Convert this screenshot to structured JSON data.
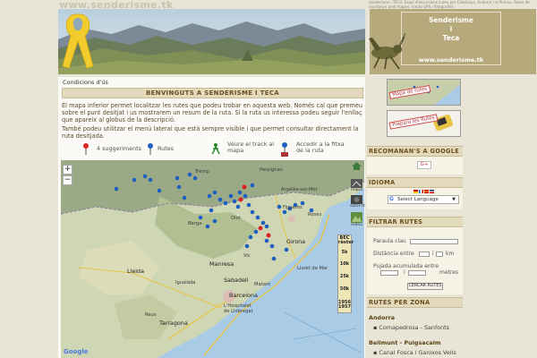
{
  "header": {
    "site_name": "www.senderisme.tk",
    "top_description": "senderisme i TECA. Espai d'excursions a peu per Catalunya, Andorra i el Pirineu. Rutes de muntanya amb mapes, tracks GPS i fotografies.",
    "brand_line1": "Senderisme",
    "brand_line2": "i",
    "brand_line3": "Teca",
    "brand_url": "www.senderisme.tk"
  },
  "main": {
    "conditions_link": "Condicions d'ús",
    "welcome_title": "BENVINGUTS A SENDERISME I TECA",
    "intro_paragraph": "El mapa inferior permet localitzar les rutes que podeu trobar en aquesta web. Només cal que premeu sobre el punt desitjat i us mostrarem un resum de la ruta. Si la ruta us interessa podeu seguir l'enllaç que apareix al globus de la descripció.",
    "menu_paragraph": "També podeu utilitzar el menú lateral que està sempre visible i que permet consultar directament la ruta desitjada.",
    "legend": {
      "suggestions": "4 suggeriments",
      "routes": "Rutes",
      "track_line1": "Veure el track al",
      "track_line2": "mapa",
      "sheet_line1": "Accedir a la fitxa",
      "sheet_line2": "de la ruta"
    }
  },
  "map": {
    "zoom_in": "+",
    "zoom_out": "−",
    "places": {
      "perpignan": "Perpignan",
      "figueres": "Figueres",
      "girona": "Girona",
      "vic": "Vic",
      "manresa": "Manresa",
      "sabadell": "Sabadell",
      "barcelona": "Barcelona",
      "hospitalet_1": "L'Hospitalet",
      "hospitalet_2": "de Llobregat",
      "lleida": "Lleida",
      "tarragona": "Tarragona",
      "argeles": "Argelès-sur-Mer",
      "roses": "Roses",
      "igualada": "Igualada",
      "mataro": "Mataró",
      "lloret": "Lloret de Mar",
      "reus": "Reus",
      "tremp": "Tremp",
      "berga": "Berga",
      "olot": "Olot"
    },
    "scale_labels": [
      "BEC\nràster",
      "5k",
      "10k",
      "25k",
      "50k",
      "1956\n1957"
    ],
    "tool_labels": {
      "map": "mapa",
      "satellite": "satel·lit",
      "relief": "relleu"
    },
    "google": "Google"
  },
  "sidebar": {
    "thumb_routes_label": "Mapa de rutes",
    "thumb_prepare_label": "Prepara les Rutes",
    "recommend_title": "RECOMANAN'S A GOOGLE",
    "gplus_label": "G+",
    "language_title": "IDIOMA",
    "select_language": "Select Language",
    "filter_title": "FILTRAR RUTES",
    "keyword_label": "Paraula clau",
    "distance_label": "Distància entre",
    "distance_and": "i",
    "distance_unit": "km",
    "climb_label": "Pujada acumulada entre",
    "climb_and": "i",
    "climb_unit": "metres",
    "search_button": "CERCAR RUTES",
    "zones_title": "RUTES PER ZONA",
    "zones": [
      {
        "name": "Andorra",
        "routes": [
          "Comapedrosa - Sanfonts"
        ]
      },
      {
        "name": "Bellmunt - Puigsacalm",
        "routes": [
          "Canal Fosca i Ganixos Vells"
        ]
      }
    ]
  },
  "colors": {
    "header_bar": "#e3d9bc",
    "header_text": "#6b4f1f",
    "brand_bg": "#b6aa7c",
    "page_bg": "#e9e5d6",
    "pin_blue": "#1f5fc2",
    "pin_red": "#d22",
    "ribbon_yellow": "#f2cc2d"
  }
}
